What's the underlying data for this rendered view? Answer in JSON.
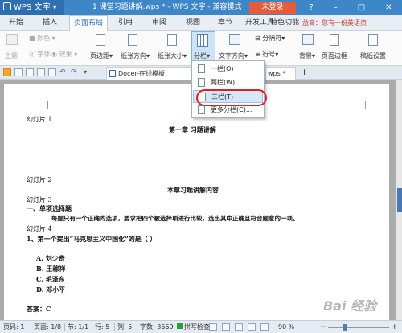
{
  "titlebar": {
    "app_name": "WPS 文字",
    "document_title": "1 课堂习题讲解.wps * - WPS 文字 - 兼容模式",
    "login_label": "未登录",
    "controls": [
      "?",
      "–",
      "□",
      "✕"
    ]
  },
  "menu": {
    "items": [
      "开始",
      "插入",
      "页面布局",
      "引用",
      "审阅",
      "视图",
      "章节",
      "开发工具",
      "特色功能"
    ],
    "active": "页面布局",
    "tip": "益商：您有一份英语资"
  },
  "ribbon": {
    "theme": "主题",
    "colors": "颜色",
    "font": "字体",
    "effects": "效果",
    "margins": "页边距",
    "orientation": "纸张方向",
    "size": "纸张大小",
    "columns": "分栏",
    "text_direction": "文字方向",
    "breaks": "分隔符",
    "line_numbers": "行号",
    "background": "背景",
    "page_border": "页面边框",
    "paper_settings": "稿纸设置"
  },
  "tabs": {
    "docer": "Docer-在线模板",
    "doc": "wps *",
    "add": "+"
  },
  "dropdown": {
    "items": [
      "一栏(O)",
      "两栏(W)",
      "三栏(T)",
      "更多分栏(C)..."
    ],
    "highlighted": "三栏(T)"
  },
  "document": {
    "slide1": "幻灯片 1",
    "chapter_title": "第一章  习题讲解",
    "slide2": "幻灯片 2",
    "section_title": "本章习题讲解内容",
    "slide3": "幻灯片 3",
    "heading1": "一、单项选择题",
    "instruction": "每题只有一个正确的选项，要求把四个被选择项进行比较，选出其中正确且符合题意的一项。",
    "slide4": "幻灯片 4",
    "question1": "1、第一个提出“马克思主义中国化”的是（    ）",
    "option_a": "A. 刘少奇",
    "option_b": "B. 王稼祥",
    "option_c": "C. 毛泽东",
    "option_d": "D. 邓小平",
    "answer": "答案：C"
  },
  "statusbar": {
    "page_num": "页码: 1",
    "pages": "页面: 1/8",
    "section": "节: 1/1",
    "row": "行: 5",
    "col": "列: 5",
    "words": "字数: 3669",
    "spellcheck": "拼写检查",
    "zoom": "90 %"
  },
  "watermark": "Bai 经验"
}
